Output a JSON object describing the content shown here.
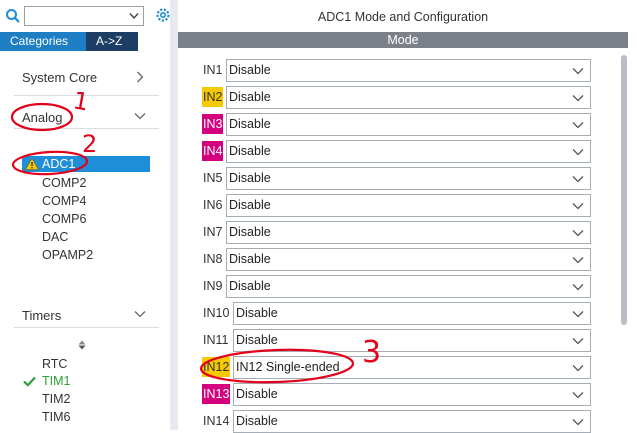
{
  "search": {
    "value": ""
  },
  "tabs": {
    "categories": "Categories",
    "atoz": "A->Z"
  },
  "sidebar": {
    "system_core": "System Core",
    "analog": "Analog",
    "analog_items": [
      "ADC1",
      "COMP2",
      "COMP4",
      "COMP6",
      "DAC",
      "OPAMP2"
    ],
    "timers": "Timers",
    "timer_items": [
      "RTC",
      "TIM1",
      "TIM2",
      "TIM6"
    ]
  },
  "panel": {
    "title": "ADC1 Mode and Configuration",
    "mode_header": "Mode"
  },
  "inputs": [
    {
      "label": "IN1",
      "value": "Disable",
      "highlight": "none"
    },
    {
      "label": "IN2",
      "value": "Disable",
      "highlight": "yellow"
    },
    {
      "label": "IN3",
      "value": "Disable",
      "highlight": "magenta"
    },
    {
      "label": "IN4",
      "value": "Disable",
      "highlight": "magenta"
    },
    {
      "label": "IN5",
      "value": "Disable",
      "highlight": "none"
    },
    {
      "label": "IN6",
      "value": "Disable",
      "highlight": "none"
    },
    {
      "label": "IN7",
      "value": "Disable",
      "highlight": "none"
    },
    {
      "label": "IN8",
      "value": "Disable",
      "highlight": "none"
    },
    {
      "label": "IN9",
      "value": "Disable",
      "highlight": "none"
    },
    {
      "label": "IN10",
      "value": "Disable",
      "highlight": "none"
    },
    {
      "label": "IN11",
      "value": "Disable",
      "highlight": "none"
    },
    {
      "label": "IN12",
      "value": "IN12 Single-ended",
      "highlight": "yellow"
    },
    {
      "label": "IN13",
      "value": "Disable",
      "highlight": "magenta"
    },
    {
      "label": "IN14",
      "value": "Disable",
      "highlight": "none"
    }
  ],
  "annotations": [
    "1",
    "2",
    "3"
  ],
  "colors": {
    "accent_blue": "#1e8ed9",
    "selected_bg": "#1e8ed9",
    "tab_active": "#1f7fc4",
    "tab_inactive": "#1c3d64",
    "pin_yellow": "#f6c900",
    "pin_magenta": "#d4007e",
    "annotation_red": "#e3001b",
    "check_green": "#2e9e3a"
  }
}
